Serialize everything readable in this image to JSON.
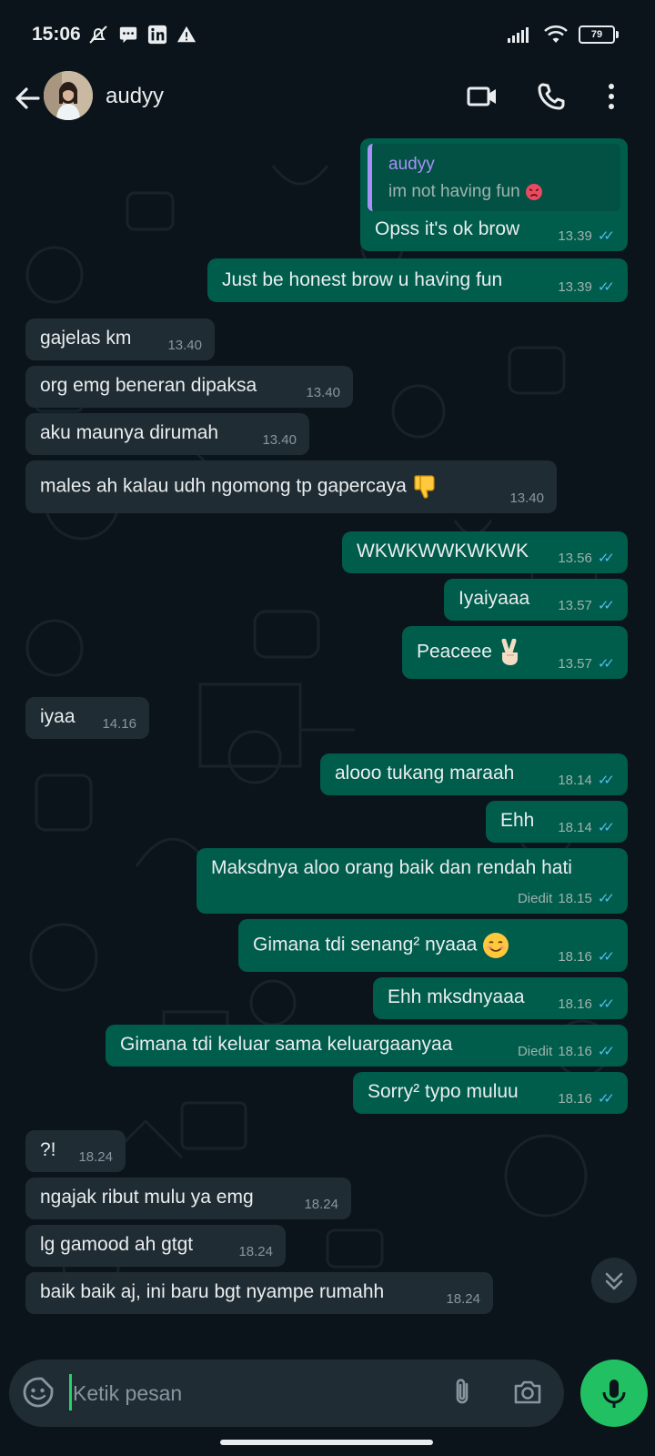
{
  "status_bar": {
    "time": "15:06",
    "battery": "79",
    "icons": [
      "mute-bell-icon",
      "message-icon",
      "linkedin-icon",
      "alert-icon",
      "signal-icon",
      "wifi-icon",
      "battery-icon"
    ]
  },
  "header": {
    "contact_name": "audyy",
    "icons": [
      "back-arrow-icon",
      "video-call-icon",
      "voice-call-icon",
      "more-vert-icon"
    ]
  },
  "messages": [
    {
      "dir": "out",
      "quote_name": "audyy",
      "quote_text": "im not having fun",
      "text": "Opss it's ok brow",
      "time": "13.39"
    },
    {
      "dir": "out",
      "text": "Just be honest brow u having fun",
      "time": "13.39"
    },
    {
      "dir": "in",
      "text": "gajelas km",
      "time": "13.40"
    },
    {
      "dir": "in",
      "text": "org emg beneran dipaksa",
      "time": "13.40"
    },
    {
      "dir": "in",
      "text": "aku maunya dirumah",
      "time": "13.40"
    },
    {
      "dir": "in",
      "text": "males ah kalau udh ngomong tp gapercaya",
      "time": "13.40"
    },
    {
      "dir": "out",
      "text": "WKWKWWKWKWK",
      "time": "13.56"
    },
    {
      "dir": "out",
      "text": "Iyaiyaaa",
      "time": "13.57"
    },
    {
      "dir": "out",
      "text": "Peaceee",
      "time": "13.57"
    },
    {
      "dir": "in",
      "text": "iyaa",
      "time": "14.16"
    },
    {
      "dir": "out",
      "text": "alooo tukang maraah",
      "time": "18.14"
    },
    {
      "dir": "out",
      "text": "Ehh",
      "time": "18.14"
    },
    {
      "dir": "out",
      "text": "Maksdnya aloo orang baik dan rendah hati",
      "time": "18.15",
      "edited": "Diedit"
    },
    {
      "dir": "out",
      "text": "Gimana tdi senang² nyaaa",
      "time": "18.16"
    },
    {
      "dir": "out",
      "text": "Ehh mksdnyaaa",
      "time": "18.16"
    },
    {
      "dir": "out",
      "text": "Gimana tdi keluar sama keluargaanyaa",
      "time": "18.16",
      "edited": "Diedit"
    },
    {
      "dir": "out",
      "text": "Sorry² typo muluu",
      "time": "18.16"
    },
    {
      "dir": "in",
      "text": "?!",
      "time": "18.24"
    },
    {
      "dir": "in",
      "text": "ngajak ribut mulu ya emg",
      "time": "18.24"
    },
    {
      "dir": "in",
      "text": "lg gamood ah gtgt",
      "time": "18.24"
    },
    {
      "dir": "in",
      "text": "baik baik aj, ini baru bgt nyampe rumahh",
      "time": "18.24"
    }
  ],
  "ticks": "✓✓",
  "input": {
    "placeholder": "Ketik pesan"
  },
  "colors": {
    "background": "#0b141a",
    "outgoing_bubble": "#005c4b",
    "incoming_bubble": "#202c33",
    "read_ticks": "#53bdeb",
    "mic_button": "#21c063",
    "quote_accent": "#a791f7"
  }
}
